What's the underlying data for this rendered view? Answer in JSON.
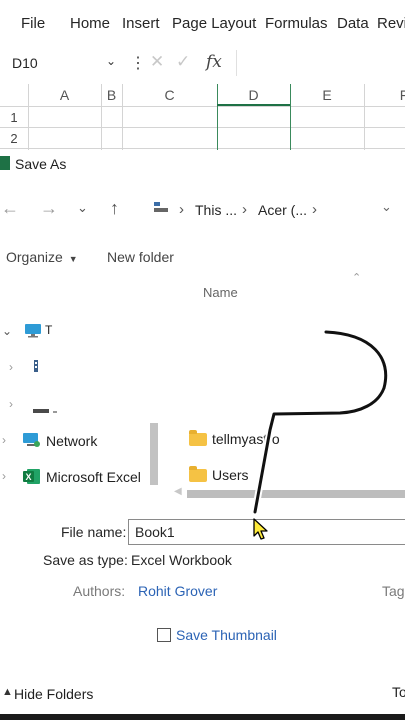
{
  "ribbon": {
    "menu": [
      "File",
      "Home",
      "Insert",
      "Page Layout",
      "Formulas",
      "Data",
      "Revi"
    ]
  },
  "formula_bar": {
    "name_box": "D10",
    "fx_label": "fx"
  },
  "grid": {
    "columns": [
      "A",
      "B",
      "C",
      "D",
      "E",
      "F"
    ],
    "rows": [
      "1",
      "2"
    ]
  },
  "dialog": {
    "title": "Save As",
    "breadcrumb": [
      "This ...",
      "Acer (..."
    ],
    "toolbar": {
      "organize": "Organize",
      "new_folder": "New folder"
    },
    "column_header": "Name",
    "nav_tree": [
      {
        "label": "T",
        "expanded": true,
        "icon": "monitor-icon"
      },
      {
        "label": "",
        "expanded": false,
        "icon": "device-icon"
      },
      {
        "label": "",
        "expanded": false,
        "icon": "drive-icon"
      },
      {
        "label": "Network",
        "expanded": false,
        "icon": "network-icon"
      },
      {
        "label": "Microsoft Excel",
        "expanded": false,
        "icon": "excel-icon"
      }
    ],
    "files": [
      {
        "name": "tellmyastro",
        "icon": "folder-icon"
      },
      {
        "name": "Users",
        "icon": "folder-icon"
      }
    ],
    "file_name_label": "File name:",
    "file_name_value": "Book1",
    "save_as_type_label": "Save as type:",
    "save_as_type_value": "Excel Workbook",
    "authors_label": "Authors:",
    "authors_value": "Rohit Grover",
    "tags_label": "Tags",
    "save_thumbnail_label": "Save Thumbnail",
    "save_thumbnail_checked": false,
    "hide_folders_label": "Hide Folders",
    "tools_label": "To"
  },
  "colors": {
    "excel_green": "#1e7145",
    "link_blue": "#2b63b5",
    "folder_yellow": "#f5c244"
  }
}
